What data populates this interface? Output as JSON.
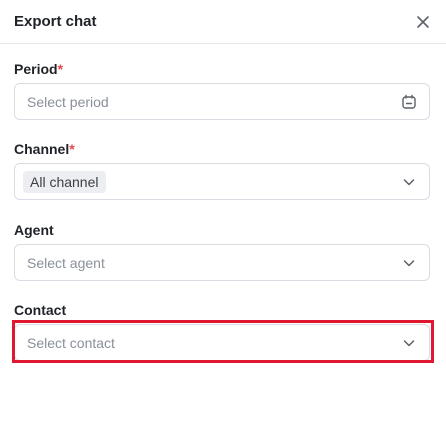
{
  "dialog": {
    "title": "Export chat"
  },
  "form": {
    "period": {
      "label": "Period",
      "required_mark": "*",
      "placeholder": "Select period"
    },
    "channel": {
      "label": "Channel",
      "required_mark": "*",
      "value": "All channel"
    },
    "agent": {
      "label": "Agent",
      "placeholder": "Select agent"
    },
    "contact": {
      "label": "Contact",
      "placeholder": "Select contact"
    }
  },
  "icons": {
    "close": "close-icon",
    "calendar": "calendar-icon",
    "dropdown": "chevron-down-icon"
  },
  "colors": {
    "required": "#e5484d",
    "highlight": "#e0182f"
  }
}
